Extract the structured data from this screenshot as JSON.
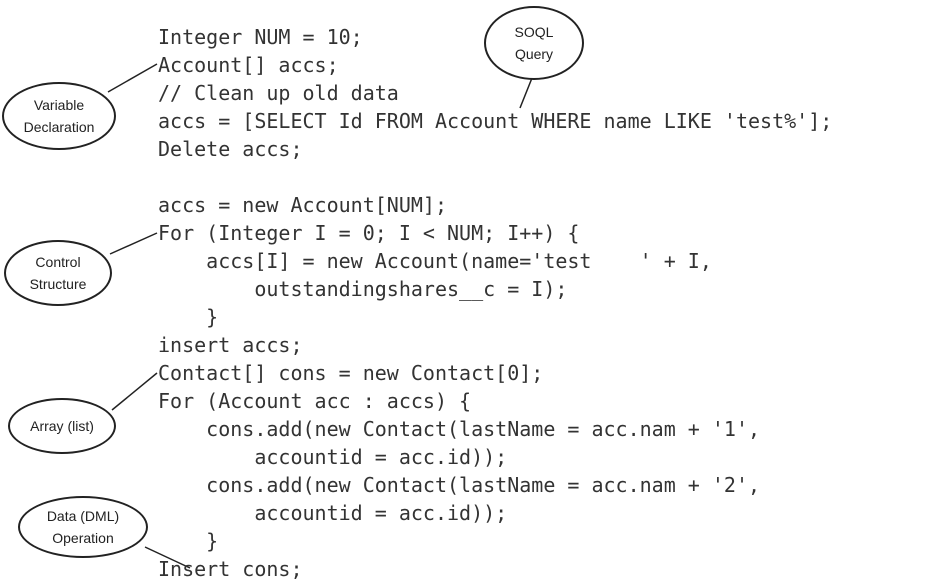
{
  "code": [
    "Integer NUM = 10;",
    "Account[] accs;",
    "// Clean up old data",
    "accs = [SELECT Id FROM Account WHERE name LIKE 'test%'];",
    "Delete accs;",
    "",
    "accs = new Account[NUM];",
    "For (Integer I = 0; I < NUM; I++) {",
    "    accs[I] = new Account(name='test    ' + I,",
    "        outstandingshares__c = I);",
    "    }",
    "insert accs;",
    "Contact[] cons = new Contact[0];",
    "For (Account acc : accs) {",
    "    cons.add(new Contact(lastName = acc.nam + '1',",
    "        accountid = acc.id));",
    "    cons.add(new Contact(lastName = acc.nam + '2',",
    "        accountid = acc.id));",
    "    }",
    "Insert cons;"
  ],
  "callouts": {
    "soql": "SOQL\nQuery",
    "variable_declaration": "Variable\nDeclaration",
    "control_structure": "Control\nStructure",
    "array": "Array (list)",
    "dml": "Data (DML)\nOperation"
  },
  "colors": {
    "code_text": "#333333",
    "outline": "#222222",
    "background": "#ffffff"
  }
}
